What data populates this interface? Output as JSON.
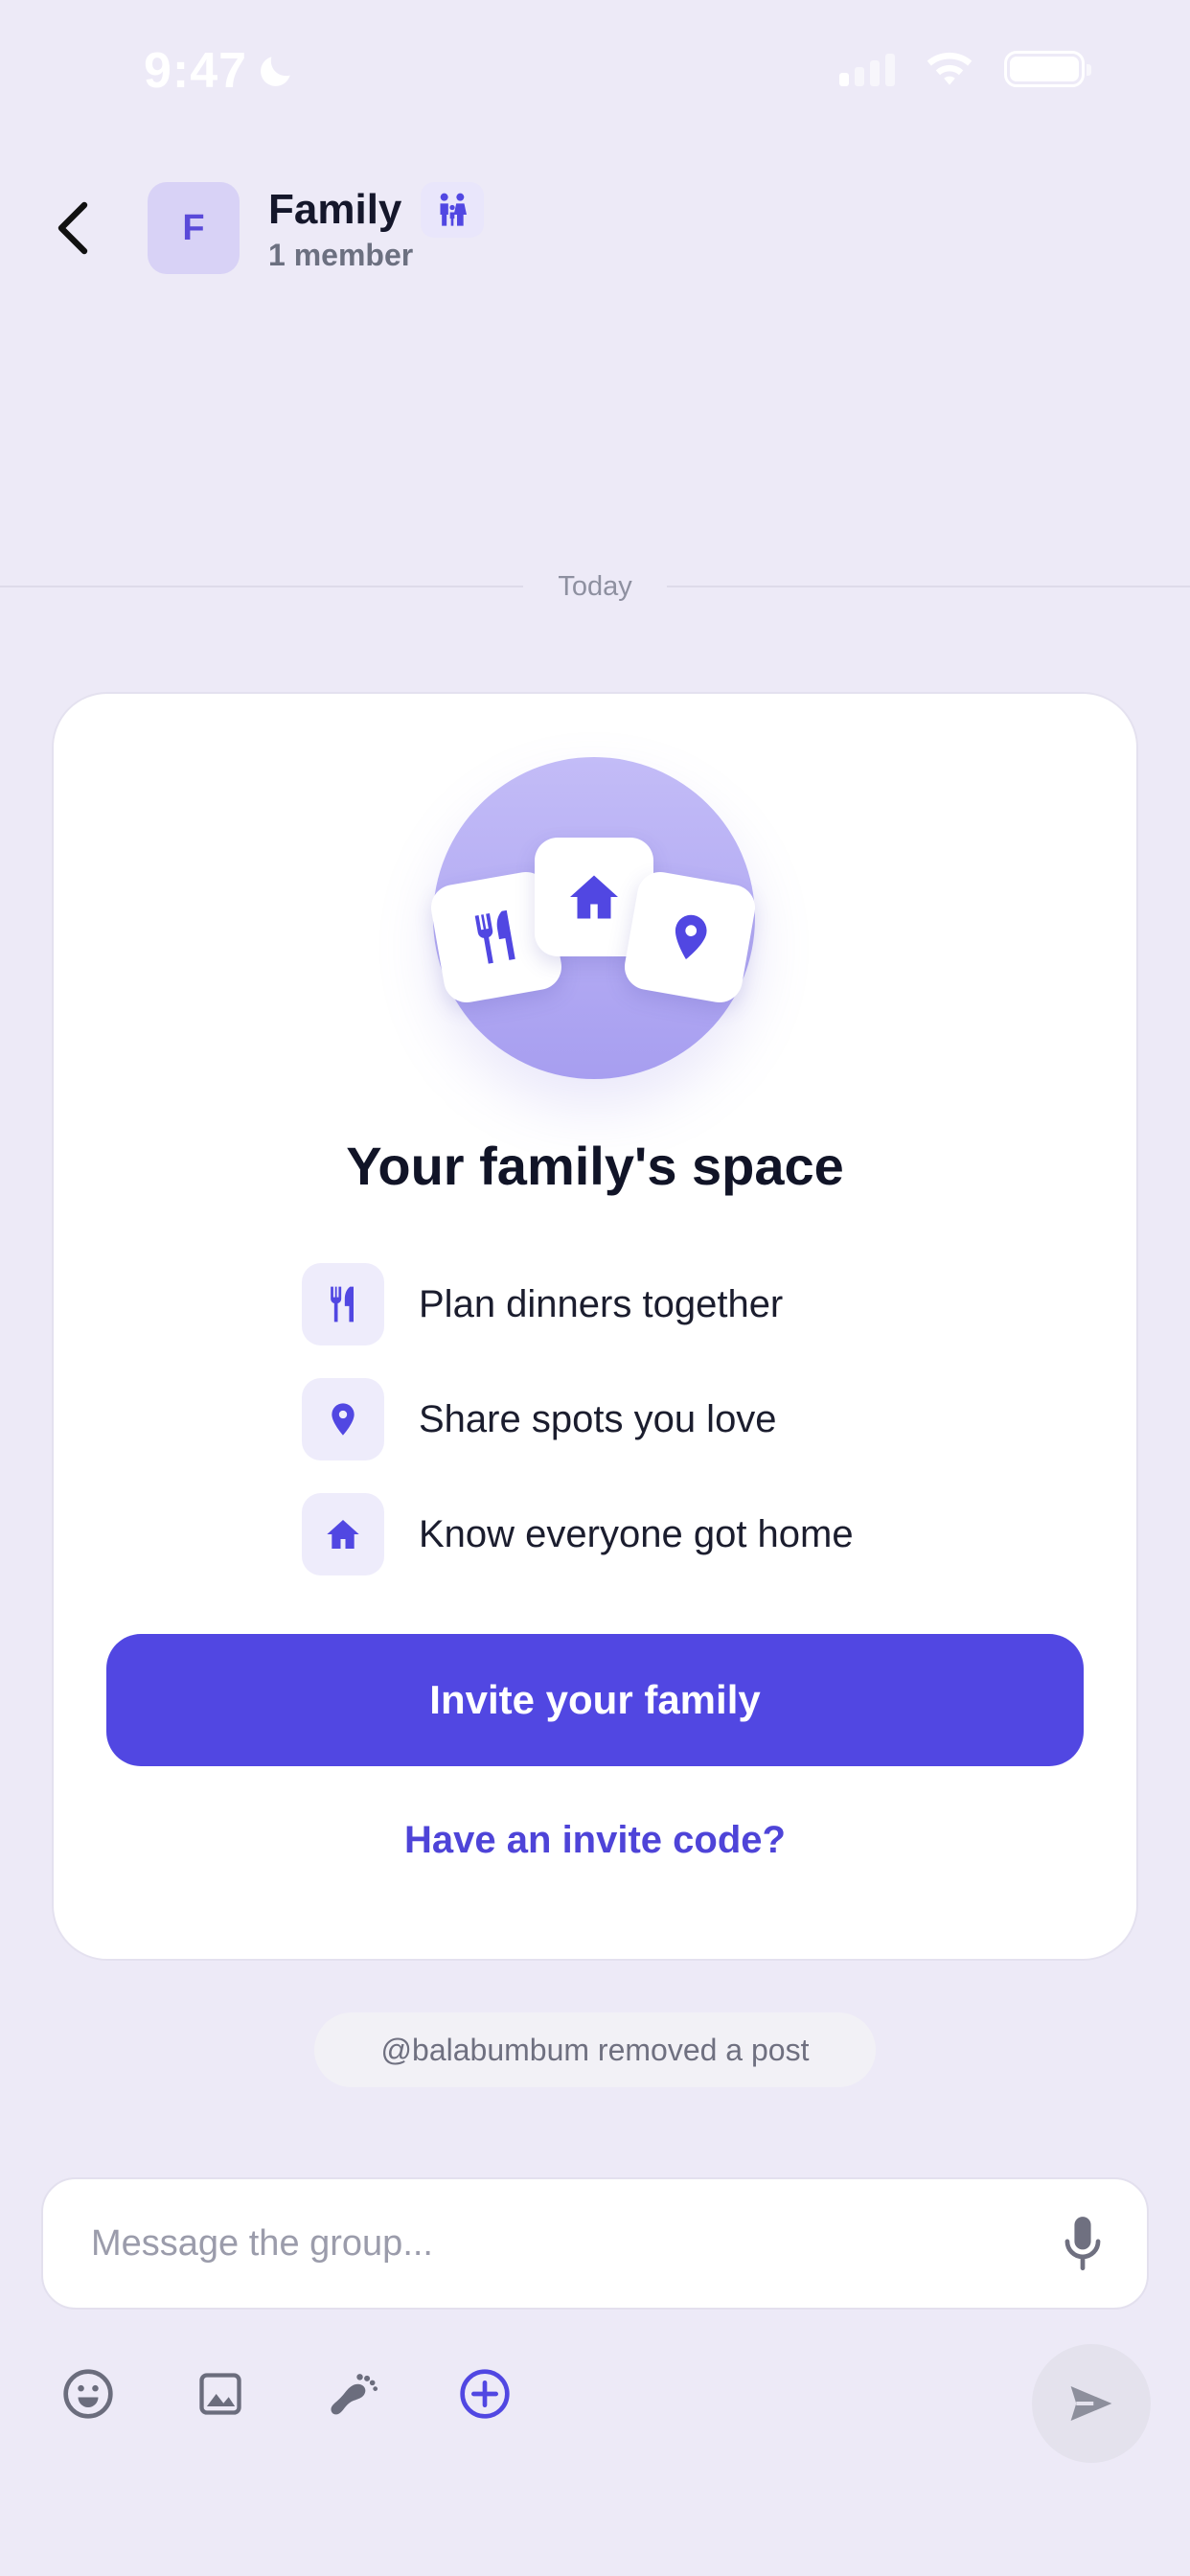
{
  "status_bar": {
    "time": "9:47",
    "icons": [
      "moon-icon",
      "cellular-signal-icon",
      "wifi-icon",
      "battery-icon"
    ]
  },
  "header": {
    "back_icon": "chevron-left-icon",
    "avatar_initial": "F",
    "group_name": "Family",
    "group_badge_icon": "family-icon",
    "member_count": "1 member"
  },
  "chat": {
    "date_divider": "Today",
    "system_message": "@balabumbum removed a post"
  },
  "welcome_card": {
    "hero_icons": [
      "fork-knife-icon",
      "home-icon",
      "map-pin-icon"
    ],
    "title": "Your family's space",
    "features": [
      {
        "icon": "fork-knife-icon",
        "label": "Plan dinners together"
      },
      {
        "icon": "map-pin-icon",
        "label": "Share spots you love"
      },
      {
        "icon": "home-icon",
        "label": "Know everyone got home"
      }
    ],
    "primary_button": "Invite your family",
    "secondary_link": "Have an invite code?"
  },
  "composer": {
    "placeholder": "Message the group...",
    "mic_icon": "microphone-icon",
    "toolbar_icons": [
      "emoji-icon",
      "image-icon",
      "footprints-icon",
      "add-circle-icon"
    ],
    "send_icon": "send-icon"
  },
  "colors": {
    "background": "#edeaf7",
    "accent": "#5147e2",
    "accent_soft": "#eeecfb",
    "card": "#ffffff"
  }
}
